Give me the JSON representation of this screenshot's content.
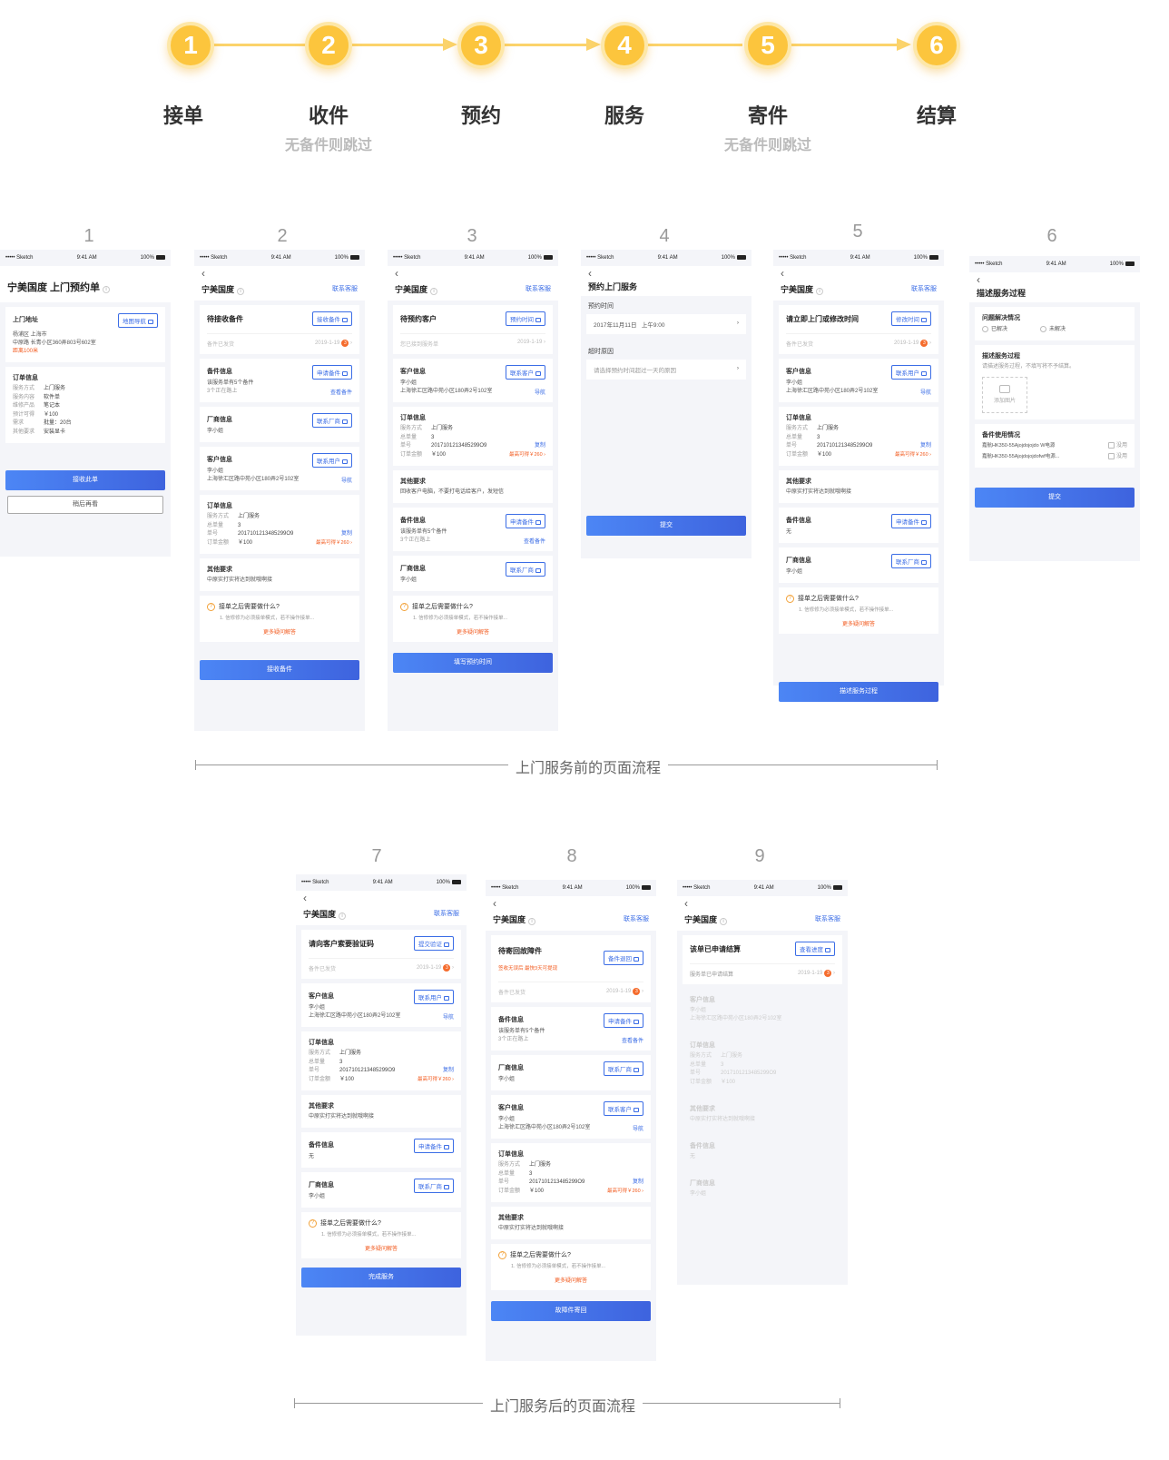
{
  "flow": {
    "steps": [
      {
        "num": "1",
        "label": "接单",
        "sub": ""
      },
      {
        "num": "2",
        "label": "收件",
        "sub": "无备件则跳过"
      },
      {
        "num": "3",
        "label": "预约",
        "sub": ""
      },
      {
        "num": "4",
        "label": "服务",
        "sub": ""
      },
      {
        "num": "5",
        "label": "寄件",
        "sub": "无备件则跳过"
      },
      {
        "num": "6",
        "label": "结算",
        "sub": ""
      }
    ],
    "accent": "#fcc53d"
  },
  "status_bar": {
    "carrier": "••••• Sketch",
    "time": "9:41 AM",
    "battery": "100%"
  },
  "screen_numbers": [
    "1",
    "2",
    "3",
    "4",
    "5",
    "6",
    "7",
    "8",
    "9"
  ],
  "sections": {
    "before": "上门服务前的页面流程",
    "after": "上门服务后的页面流程"
  },
  "common": {
    "back": "‹",
    "shop": "宁美国度",
    "contact_service": "联系客服",
    "meta_date": "2019-1-19",
    "meta_badge": "3",
    "spare_info": "备件信息",
    "apply_spare": "申请备件",
    "spare_desc": "该服务单有5个备件",
    "spare_road": "3个正在路上",
    "view_spare": "查看备件",
    "vendor_info": "厂商信息",
    "contact_vendor": "联系厂商",
    "vendor_name": "李小姐",
    "customer_info": "客户信息",
    "contact_user": "联系用户",
    "contact_customer": "联系客户",
    "customer_name": "李小姐",
    "customer_addr": "上海徐汇区路中苑小区180弄2号102室",
    "navigate": "导航",
    "order_info": "订单信息",
    "k_service": "服务方式",
    "v_service": "上门服务",
    "k_count": "总单量",
    "v_count": "3",
    "k_no": "单号",
    "v_no": "2017101213485299O9",
    "copy": "复制",
    "k_amount": "订单金额",
    "v_amount": "￥100",
    "max_amount": "最高可得￥260 ›",
    "other_req": "其他要求",
    "other_req_text": "中原实打实将达到就哦啊接",
    "faq_q": "接单之后需要做什么?",
    "faq_a": "1. 信修修为必须接单模式，若不操作接单...",
    "faq_more": "更多疑问解答",
    "none": "无"
  },
  "s1": {
    "title": "宁美国度  上门预约单",
    "addr_label": "上门地址",
    "map_btn": "地图导航",
    "addr1": "杨浦区 上海市",
    "addr2": "中原路 长青小区360弄803号602室",
    "distance": "距离100米",
    "order_label": "订单信息",
    "rows": [
      {
        "k": "服务方式",
        "v": "上门服务"
      },
      {
        "k": "服务内容",
        "v": "软件单"
      },
      {
        "k": "维修产品",
        "v": "笔记本"
      },
      {
        "k": "预计可得",
        "v": "￥100"
      },
      {
        "k": "需求",
        "v": "批量：20台"
      },
      {
        "k": "其他要求",
        "v": "安装显卡"
      }
    ],
    "accept": "接收此单",
    "later": "稍后再看"
  },
  "s2": {
    "card_title": "待接收备件",
    "card_btn": "接收备件",
    "meta_left": "备件已发货",
    "bottom": "接收备件"
  },
  "s3": {
    "card_title": "待预约客户",
    "card_btn": "预约时间",
    "meta_left": "您已接到服务单",
    "other_text": "回收客户电脑，不要打电话给客户，发短信",
    "bottom": "填写预约时间"
  },
  "s4": {
    "title": "预约上门服务",
    "time_label": "预约时间",
    "date": "2017年11月11日",
    "ampm": "上午9:00",
    "reason_label": "超时原因",
    "reason_ph": "请选择预约时间超过一天的原因",
    "submit": "提交"
  },
  "s5": {
    "card_title": "请立即上门或修改时间",
    "card_btn": "修改时间",
    "meta_left": "备件已发货",
    "bottom": "描述服务过程"
  },
  "s6": {
    "title": "描述服务过程",
    "q_label": "问题解决情况",
    "opt1": "已解决",
    "opt2": "未解决",
    "desc_label": "描述服务过程",
    "desc_ph": "请描述服务过程，不填写将不予结算。",
    "add_img": "添加图片",
    "usage_label": "备件使用情况",
    "part1": "嘉航HK350-55Ajojdojojdo W电源",
    "part2": "嘉航HK350-55Ajojdojojdofwf电源...",
    "unused": "没用",
    "submit": "提交"
  },
  "s7": {
    "card_title": "请向客户索要验证码",
    "card_btn": "提交验证",
    "meta_left": "备件已发货",
    "bottom": "完成服务"
  },
  "s8": {
    "card_title": "待寄回故障件",
    "card_sub": "签收无误后 最快3天可提现",
    "card_btn": "备件退回",
    "meta_left": "备件已发货",
    "bottom": "故障件寄回"
  },
  "s9": {
    "card_title": "该单已申请结算",
    "card_btn": "查看进度",
    "meta_left": "服务单已申请结算"
  }
}
